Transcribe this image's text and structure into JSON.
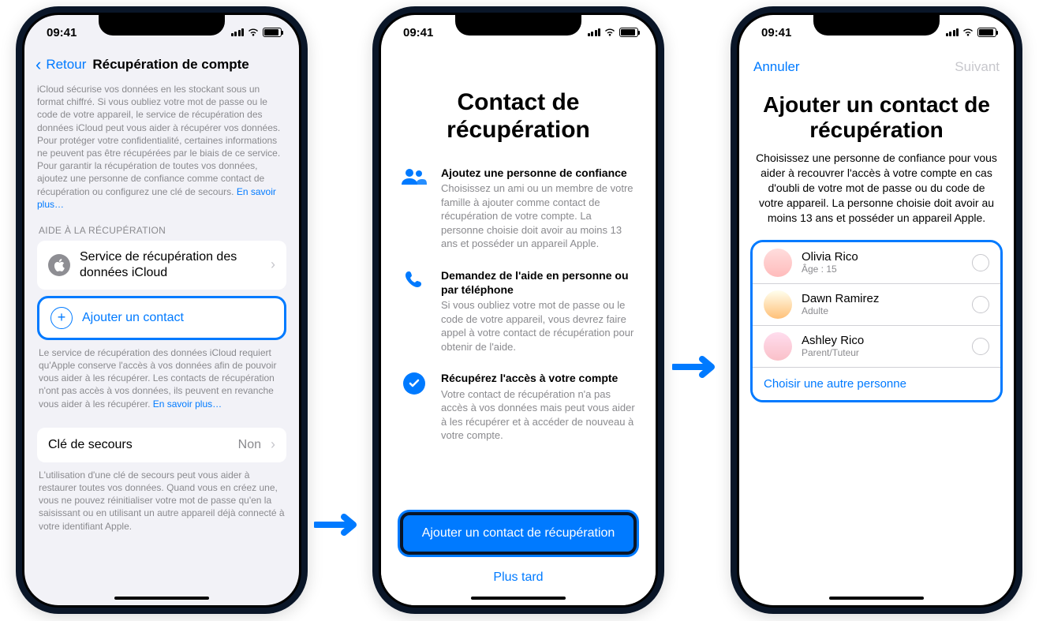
{
  "status": {
    "time": "09:41"
  },
  "phone1": {
    "back": "Retour",
    "title": "Récupération de compte",
    "desc": "iCloud sécurise vos données en les stockant sous un format chiffré. Si vous oubliez votre mot de passe ou le code de votre appareil, le service de récupération des données iCloud peut vous aider à récupérer vos données. Pour protéger votre confidentialité, certaines informations ne peuvent pas être récupérées par le biais de ce service. Pour garantir la récupération de toutes vos données, ajoutez une personne de confiance comme contact de récupération ou configurez une clé de secours. ",
    "desc_link": "En savoir plus…",
    "section": "AIDE À LA RÉCUPÉRATION",
    "row_icloud": "Service de récupération des données iCloud",
    "row_add": "Ajouter un contact",
    "footer1": "Le service de récupération des données iCloud requiert qu'Apple conserve l'accès à vos données afin de pouvoir vous aider à les récupérer. Les contacts de récupération n'ont pas accès à vos données, ils peuvent en revanche vous aider à les récupérer. ",
    "footer1_link": "En savoir plus…",
    "row_key": "Clé de secours",
    "row_key_value": "Non",
    "footer2": "L'utilisation d'une clé de secours peut vous aider à restaurer toutes vos données. Quand vous en créez une, vous ne pouvez réinitialiser votre mot de passe qu'en la saisissant ou en utilisant un autre appareil déjà connecté à votre identifiant Apple."
  },
  "phone2": {
    "title": "Contact de récupération",
    "f1_title": "Ajoutez une personne de confiance",
    "f1_desc": "Choisissez un ami ou un membre de votre famille à ajouter comme contact de récupération de votre compte. La personne choisie doit avoir au moins 13 ans et posséder un appareil Apple.",
    "f2_title": "Demandez de l'aide en personne ou par téléphone",
    "f2_desc": "Si vous oubliez votre mot de passe ou le code de votre appareil, vous devrez faire appel à votre contact de récupération pour obtenir de l'aide.",
    "f3_title": "Récupérez l'accès à votre compte",
    "f3_desc": "Votre contact de récupération n'a pas accès à vos données mais peut vous aider à les récupérer et à accéder de nouveau à votre compte.",
    "primary": "Ajouter un contact de récupération",
    "secondary": "Plus tard"
  },
  "phone3": {
    "cancel": "Annuler",
    "next": "Suivant",
    "title": "Ajouter un contact de récupération",
    "desc": "Choisissez une personne de confiance pour vous aider à recouvrer l'accès à votre compte en cas d'oubli de votre mot de passe ou du code de votre appareil. La personne choisie doit avoir au moins 13 ans et posséder un appareil Apple.",
    "contacts": [
      {
        "name": "Olivia Rico",
        "sub": "Âge : 15"
      },
      {
        "name": "Dawn Ramirez",
        "sub": "Adulte"
      },
      {
        "name": "Ashley Rico",
        "sub": "Parent/Tuteur"
      }
    ],
    "choose_other": "Choisir une autre personne"
  }
}
